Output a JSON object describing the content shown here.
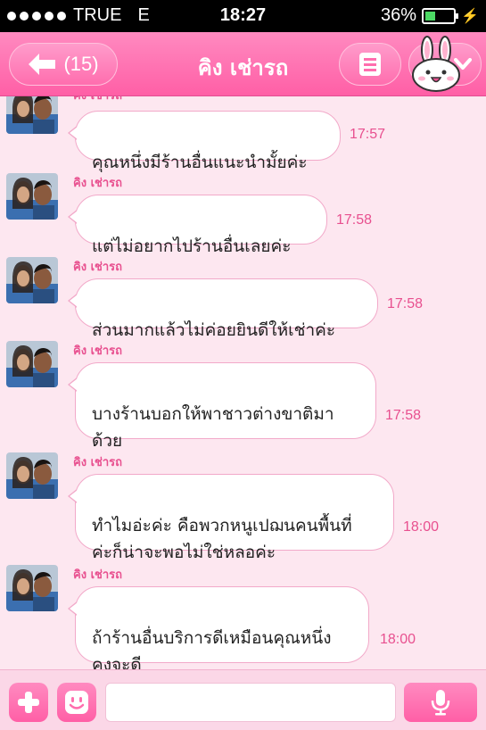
{
  "status_bar": {
    "carrier": "TRUE",
    "network": "E",
    "time": "18:27",
    "battery": "36%",
    "battery_level": 0.36
  },
  "header": {
    "back_label": "(15)",
    "title": "คิง เช่ารถ",
    "icons": [
      "arrow-left-icon",
      "menu-icon",
      "chevron-down-icon",
      "bunny-sticker-icon"
    ]
  },
  "messages": [
    {
      "sender": "คิง เช่ารถ",
      "text": "คุณหนึ่งมีร้านอื่นแนะนำมั้ยค่ะ",
      "time": "17:57"
    },
    {
      "sender": "คิง เช่ารถ",
      "text": "แต่ไม่อยากไปร้านอื่นเลยค่ะ",
      "time": "17:58"
    },
    {
      "sender": "คิง เช่ารถ",
      "text": "ส่วนมากแล้วไม่ค่อยยินดีให้เช่าค่ะ",
      "time": "17:58"
    },
    {
      "sender": "คิง เช่ารถ",
      "text": "บางร้านบอกให้พาชาวต่างขาติมา\nด้วย",
      "time": "17:58"
    },
    {
      "sender": "คิง เช่ารถ",
      "text": "ทำไมอ่ะค่ะ คือพวกหนูเปฌนคนพื้นที่\nค่ะก็น่าจะพอไม่ใช่หลอค่ะ",
      "time": "18:00"
    },
    {
      "sender": "คิง เช่ารถ",
      "text": "ถ้าร้านอื่นบริการดีเหมือนคุณหนึ่ง\nคงจะดี",
      "time": "18:00"
    }
  ],
  "input_bar": {
    "placeholder": "",
    "value": "",
    "icons": [
      "plus-icon",
      "emoji-icon",
      "microphone-icon"
    ]
  },
  "colors": {
    "header_pink": "#ff6eae",
    "accent_pink": "#e8508f",
    "background": "#fde7f0"
  }
}
